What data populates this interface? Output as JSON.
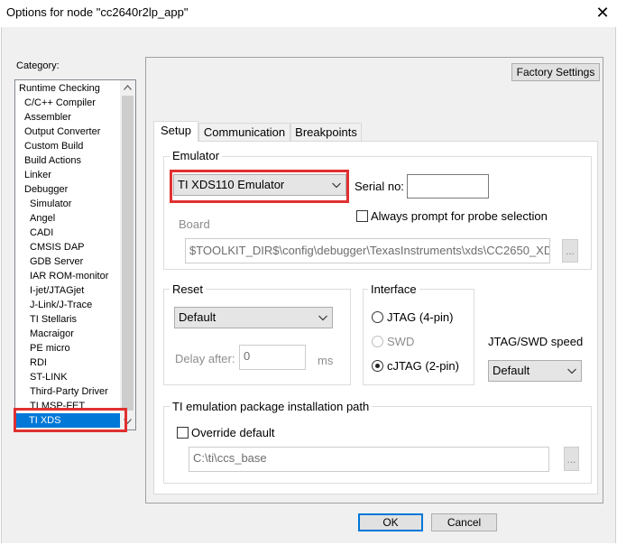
{
  "window": {
    "title": "Options for node \"cc2640r2lp_app\"",
    "close_glyph": "✕"
  },
  "category": {
    "label": "Category:",
    "items": [
      {
        "label": "Runtime Checking",
        "indent": 0
      },
      {
        "label": "C/C++ Compiler",
        "indent": 1
      },
      {
        "label": "Assembler",
        "indent": 1
      },
      {
        "label": "Output Converter",
        "indent": 1
      },
      {
        "label": "Custom Build",
        "indent": 1
      },
      {
        "label": "Build Actions",
        "indent": 1
      },
      {
        "label": "Linker",
        "indent": 1
      },
      {
        "label": "Debugger",
        "indent": 1
      },
      {
        "label": "Simulator",
        "indent": 2
      },
      {
        "label": "Angel",
        "indent": 2
      },
      {
        "label": "CADI",
        "indent": 2
      },
      {
        "label": "CMSIS DAP",
        "indent": 2
      },
      {
        "label": "GDB Server",
        "indent": 2
      },
      {
        "label": "IAR ROM-monitor",
        "indent": 2
      },
      {
        "label": "I-jet/JTAGjet",
        "indent": 2
      },
      {
        "label": "J-Link/J-Trace",
        "indent": 2
      },
      {
        "label": "TI Stellaris",
        "indent": 2
      },
      {
        "label": "Macraigor",
        "indent": 2
      },
      {
        "label": "PE micro",
        "indent": 2
      },
      {
        "label": "RDI",
        "indent": 2
      },
      {
        "label": "ST-LINK",
        "indent": 2
      },
      {
        "label": "Third-Party Driver",
        "indent": 2
      },
      {
        "label": "TI MSP-FET",
        "indent": 2
      },
      {
        "label": "TI XDS",
        "indent": 2,
        "selected": true
      }
    ]
  },
  "factory_settings_label": "Factory Settings",
  "tabs": [
    {
      "label": "Setup",
      "active": true
    },
    {
      "label": "Communication",
      "active": false
    },
    {
      "label": "Breakpoints",
      "active": false
    }
  ],
  "emulator": {
    "group_title": "Emulator",
    "selected": "TI XDS110 Emulator",
    "serial_label": "Serial no:",
    "serial_value": "",
    "always_prompt_label": "Always prompt for probe selection",
    "board_label": "Board",
    "board_path": "$TOOLKIT_DIR$\\config\\debugger\\TexasInstruments\\xds\\CC2650_XD",
    "browse_label": "..."
  },
  "reset": {
    "group_title": "Reset",
    "selected": "Default",
    "delay_label": "Delay after:",
    "delay_value": "0",
    "delay_unit": "ms"
  },
  "interface": {
    "group_title": "Interface",
    "options": [
      {
        "label": "JTAG  (4-pin)",
        "checked": false,
        "disabled": false
      },
      {
        "label": "SWD",
        "checked": false,
        "disabled": true
      },
      {
        "label": "cJTAG  (2-pin)",
        "checked": true,
        "disabled": false
      }
    ]
  },
  "speed": {
    "label": "JTAG/SWD speed",
    "selected": "Default"
  },
  "ti_emulation": {
    "group_title": "TI emulation package installation path",
    "override_label": "Override default",
    "path": "C:\\ti\\ccs_base",
    "browse_label": "..."
  },
  "buttons": {
    "ok": "OK",
    "cancel": "Cancel"
  },
  "colors": {
    "highlight_red": "#e03030",
    "selection_blue": "#0078d7"
  }
}
